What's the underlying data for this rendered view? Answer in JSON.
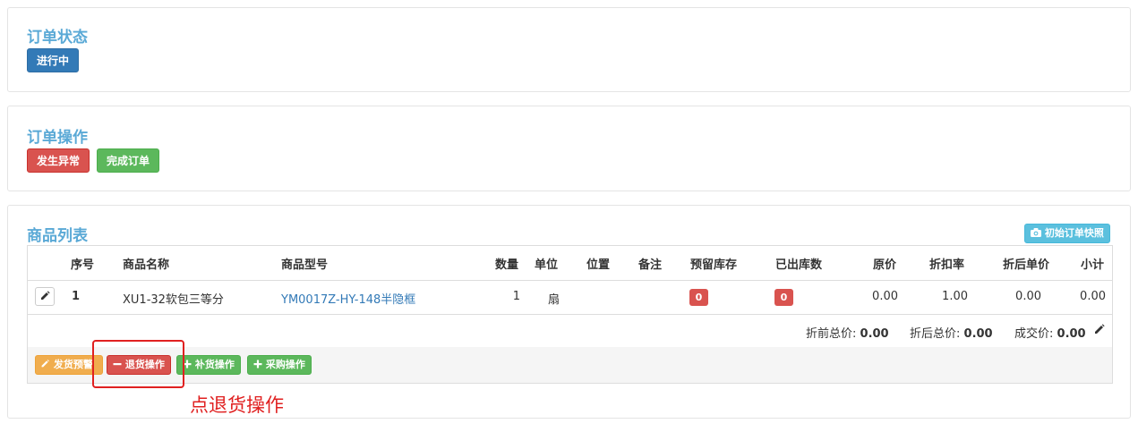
{
  "order_status": {
    "title": "订单状态",
    "badge": "进行中",
    "badge_color": "#337ab7"
  },
  "order_ops": {
    "title": "订单操作",
    "btn_exception": "发生异常",
    "btn_complete": "完成订单"
  },
  "product_list": {
    "title": "商品列表",
    "snapshot_btn": "初始订单快照",
    "columns": [
      "序号",
      "商品名称",
      "商品型号",
      "数量",
      "单位",
      "位置",
      "备注",
      "预留库存",
      "已出库数",
      "原价",
      "折扣率",
      "折后单价",
      "小计"
    ],
    "rows": [
      {
        "index": "1",
        "name": "XU1-32软包三等分",
        "model": "YM0017Z-HY-148半隐框",
        "qty": "1",
        "unit": "扇",
        "location": "",
        "note": "",
        "reserved": "0",
        "shipped": "0",
        "price": "0.00",
        "discount": "1.00",
        "disc_price": "0.00",
        "subtotal": "0.00"
      }
    ],
    "summary": {
      "before_label": "折前总价:",
      "before_value": "0.00",
      "after_label": "折后总价:",
      "after_value": "0.00",
      "deal_label": "成交价:",
      "deal_value": "0.00"
    },
    "actions": {
      "ship_warning": "发货预警",
      "return_op": "退货操作",
      "restock_op": "补货操作",
      "purchase_op": "采购操作"
    }
  },
  "annotation": {
    "text": "点退货操作",
    "color": "#e02020"
  }
}
